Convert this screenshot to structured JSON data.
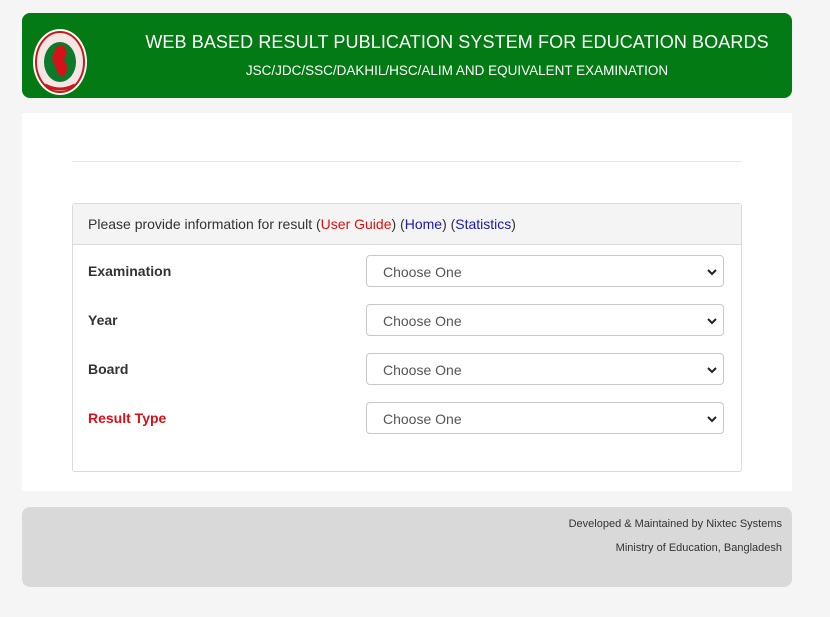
{
  "header": {
    "title": "WEB BASED RESULT PUBLICATION SYSTEM FOR EDUCATION BOARDS",
    "subtitle": "JSC/JDC/SSC/DAKHIL/HSC/ALIM AND EQUIVALENT EXAMINATION",
    "logo_icon": "bangladesh-govt-seal-icon"
  },
  "panel": {
    "prompt": "Please provide information for result",
    "open_paren": " (",
    "close_open": ") (",
    "close_paren": ")",
    "user_guide": "User Guide",
    "home": "Home",
    "statistics": "Statistics",
    "fields": [
      {
        "label": "Examination",
        "value": "Choose One"
      },
      {
        "label": "Year",
        "value": "Choose One"
      },
      {
        "label": "Board",
        "value": "Choose One"
      },
      {
        "label": "Result Type",
        "value": "Choose One"
      }
    ]
  },
  "footer": {
    "line1": "Developed & Maintained by Nixtec Systems",
    "line2": "Ministry of Education, Bangladesh"
  },
  "colors": {
    "header_green": "#037a14",
    "link_red": "#d11111",
    "link_blue": "#1a1aa6",
    "result_type_red": "#d4121a"
  }
}
